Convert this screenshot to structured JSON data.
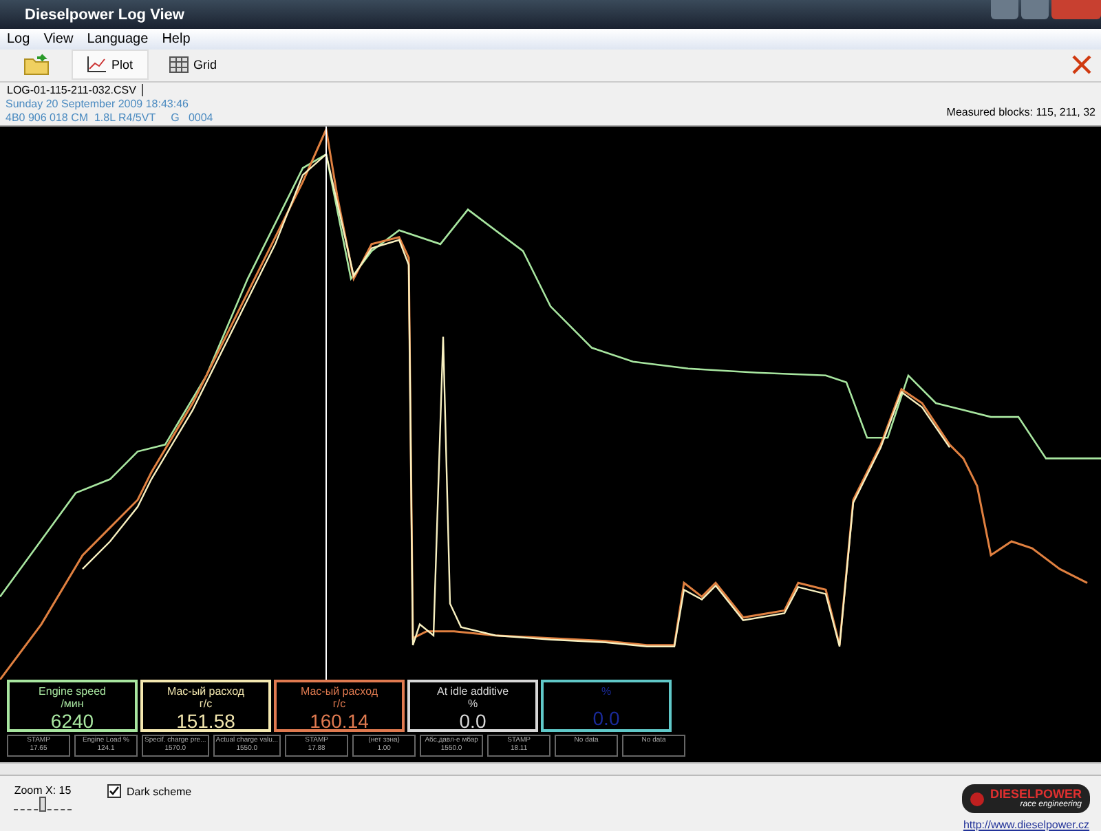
{
  "window": {
    "title": "Dieselpower Log View"
  },
  "menu": [
    "Log",
    "View",
    "Language",
    "Help"
  ],
  "toolbar": [
    {
      "kind": "open"
    },
    {
      "kind": "plot",
      "label": "Plot",
      "selected": true
    },
    {
      "kind": "grid",
      "label": "Grid",
      "selected": false
    }
  ],
  "file_tab": {
    "label": "LOG-01-115-211-032.CSV"
  },
  "info": {
    "date": "Sunday 20 September 2009 18:43:46",
    "ecu": "4B0 906 018 CM  1.8L R4/5VT     G   0004",
    "blocks": "Measured blocks: 115, 211, 32"
  },
  "gauges": [
    {
      "label": "Engine speed",
      "unit": "/мин",
      "value": "6240",
      "color": "#a8e6a0",
      "selected": false
    },
    {
      "label": "Мас-ый расход",
      "unit": "г/с",
      "value": "151.58",
      "color": "#f4e8b0",
      "selected": false
    },
    {
      "label": "Мас-ый расход",
      "unit": "г/с",
      "value": "160.14",
      "color": "#e07a50",
      "selected": false
    },
    {
      "label": "At idle additive",
      "unit": "%",
      "value": "0.0",
      "color": "#d8d8d8",
      "selected": false
    },
    {
      "unit": "%",
      "value": "0.0",
      "color": "#1a2a9a",
      "selected": true
    }
  ],
  "cells": [
    {
      "label": "STAMP",
      "value": "17.65"
    },
    {
      "label": "Engine Load %",
      "value": "124.1"
    },
    {
      "label": "Specif. charge pre...",
      "value": "1570.0"
    },
    {
      "label": "Actual charge valu...",
      "value": "1550.0"
    },
    {
      "label": "STAMP",
      "value": "17.88"
    },
    {
      "label": "(нет зэна)",
      "value": "1.00"
    },
    {
      "label": "Абс.давл-е мбар",
      "value": "1550.0"
    },
    {
      "label": "STAMP",
      "value": "18.11"
    },
    {
      "label": "No data"
    },
    {
      "label": "No data"
    }
  ],
  "zoom": {
    "label": "Zoom X: 15",
    "level": 0.5
  },
  "dark_scheme": {
    "label": "Dark scheme",
    "checked": true
  },
  "logo": {
    "name": "DIESELPOWER",
    "tagline": "race engineering"
  },
  "link": "http://www.dieselpower.cz"
}
